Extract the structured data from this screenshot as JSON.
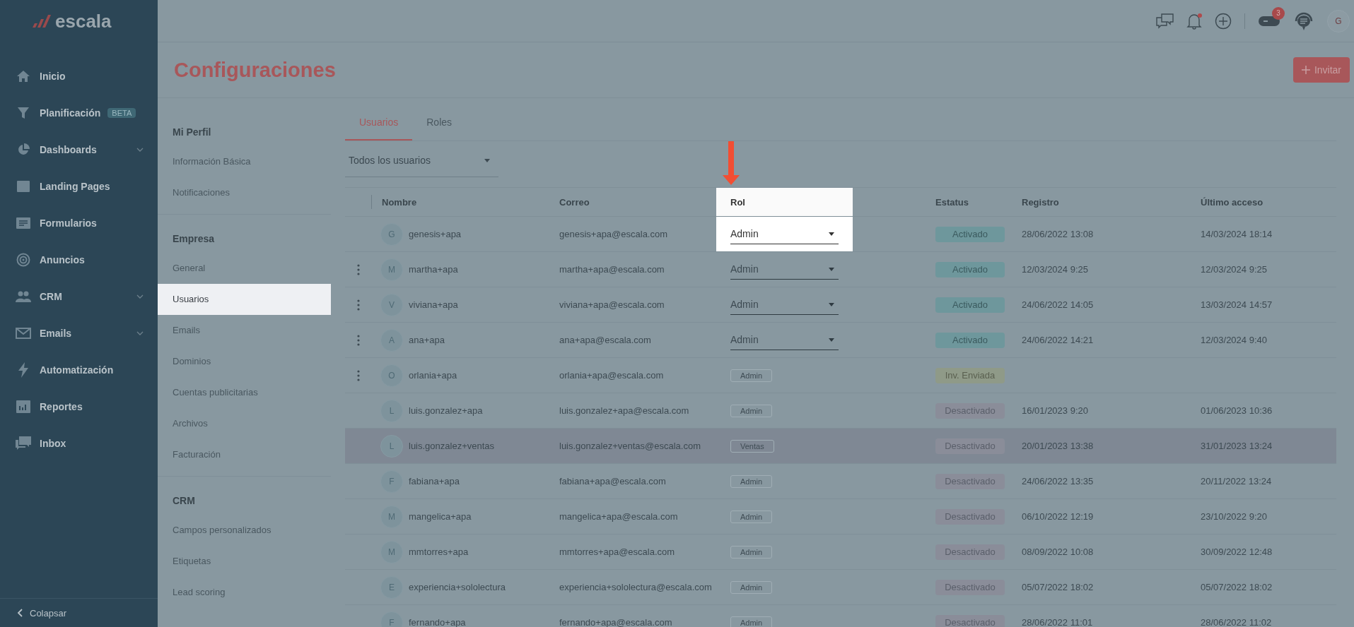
{
  "app": {
    "logo": "escala"
  },
  "sidebar": {
    "items": [
      {
        "kind": "home",
        "label": "Inicio",
        "expandable": false
      },
      {
        "kind": "filter",
        "label": "Planificación",
        "badge": "BETA",
        "expandable": false
      },
      {
        "kind": "pie",
        "label": "Dashboards",
        "expandable": true
      },
      {
        "kind": "page",
        "label": "Landing Pages",
        "expandable": false
      },
      {
        "kind": "form",
        "label": "Formularios",
        "expandable": false
      },
      {
        "kind": "target",
        "label": "Anuncios",
        "expandable": false
      },
      {
        "kind": "people",
        "label": "CRM",
        "expandable": true
      },
      {
        "kind": "mail",
        "label": "Emails",
        "expandable": true
      },
      {
        "kind": "bolt",
        "label": "Automatización",
        "expandable": false
      },
      {
        "kind": "chart",
        "label": "Reportes",
        "expandable": false
      },
      {
        "kind": "inbox",
        "label": "Inbox",
        "expandable": false
      }
    ],
    "collapse": "Colapsar"
  },
  "topbar": {
    "bell_unread": true,
    "games_badge": "3",
    "avatar": "G"
  },
  "page": {
    "title": "Configuraciones",
    "invite_button": "Invitar"
  },
  "settings_nav": [
    {
      "title": "Mi Perfil",
      "items": [
        {
          "label": "Información Básica",
          "selected": false
        },
        {
          "label": "Notificaciones",
          "selected": false
        }
      ]
    },
    {
      "title": "Empresa",
      "items": [
        {
          "label": "General",
          "selected": false
        },
        {
          "label": "Usuarios",
          "selected": true
        },
        {
          "label": "Emails",
          "selected": false
        },
        {
          "label": "Dominios",
          "selected": false
        },
        {
          "label": "Cuentas publicitarias",
          "selected": false
        },
        {
          "label": "Archivos",
          "selected": false
        },
        {
          "label": "Facturación",
          "selected": false
        }
      ]
    },
    {
      "title": "CRM",
      "items": [
        {
          "label": "Campos personalizados",
          "selected": false
        },
        {
          "label": "Etiquetas",
          "selected": false
        },
        {
          "label": "Lead scoring",
          "selected": false
        }
      ]
    }
  ],
  "tabs": [
    {
      "label": "Usuarios",
      "selected": true
    },
    {
      "label": "Roles",
      "selected": false
    }
  ],
  "filter": {
    "value": "Todos los usuarios"
  },
  "table": {
    "columns": [
      {
        "label": "Nombre",
        "spotlight": false
      },
      {
        "label": "Correo",
        "spotlight": false
      },
      {
        "label": "Rol",
        "spotlight": true
      },
      {
        "label": "Estatus",
        "spotlight": false
      },
      {
        "label": "Registro",
        "spotlight": false
      },
      {
        "label": "Último acceso",
        "spotlight": false
      }
    ],
    "rows": [
      {
        "initial": "G",
        "name": "genesis+apa",
        "email": "genesis+apa@escala.com",
        "role": {
          "label": "Admin",
          "kind": "select"
        },
        "status": {
          "label": "Activado",
          "kind": "active"
        },
        "registered": "28/06/2022 13:08",
        "last_access": "14/03/2024 18:14",
        "menu": false,
        "hovered": false,
        "spotlight": true
      },
      {
        "initial": "M",
        "name": "martha+apa",
        "email": "martha+apa@escala.com",
        "role": {
          "label": "Admin",
          "kind": "select"
        },
        "status": {
          "label": "Activado",
          "kind": "active"
        },
        "registered": "12/03/2024 9:25",
        "last_access": "12/03/2024 9:25",
        "menu": true,
        "hovered": false,
        "spotlight": false
      },
      {
        "initial": "V",
        "name": "viviana+apa",
        "email": "viviana+apa@escala.com",
        "role": {
          "label": "Admin",
          "kind": "select"
        },
        "status": {
          "label": "Activado",
          "kind": "active"
        },
        "registered": "24/06/2022 14:05",
        "last_access": "13/03/2024 14:57",
        "menu": true,
        "hovered": false,
        "spotlight": false
      },
      {
        "initial": "A",
        "name": "ana+apa",
        "email": "ana+apa@escala.com",
        "role": {
          "label": "Admin",
          "kind": "select"
        },
        "status": {
          "label": "Activado",
          "kind": "active"
        },
        "registered": "24/06/2022 14:21",
        "last_access": "12/03/2024 9:40",
        "menu": true,
        "hovered": false,
        "spotlight": false
      },
      {
        "initial": "O",
        "name": "orlania+apa",
        "email": "orlania+apa@escala.com",
        "role": {
          "label": "Admin",
          "kind": "tag"
        },
        "status": {
          "label": "Inv. Enviada",
          "kind": "invited"
        },
        "menu": true,
        "hovered": false,
        "spotlight": false
      },
      {
        "initial": "L",
        "name": "luis.gonzalez+apa",
        "email": "luis.gonzalez+apa@escala.com",
        "role": {
          "label": "Admin",
          "kind": "tag"
        },
        "status": {
          "label": "Desactivado",
          "kind": "inactive"
        },
        "registered": "16/01/2023 9:20",
        "last_access": "01/06/2023 10:36",
        "menu": false,
        "hovered": false,
        "spotlight": false
      },
      {
        "initial": "L",
        "name": "luis.gonzalez+ventas",
        "email": "luis.gonzalez+ventas@escala.com",
        "role": {
          "label": "Ventas",
          "kind": "tag"
        },
        "status": {
          "label": "Desactivado",
          "kind": "inactive"
        },
        "registered": "20/01/2023 13:38",
        "last_access": "31/01/2023 13:24",
        "menu": false,
        "hovered": true,
        "spotlight": false
      },
      {
        "initial": "F",
        "name": "fabiana+apa",
        "email": "fabiana+apa@escala.com",
        "role": {
          "label": "Admin",
          "kind": "tag"
        },
        "status": {
          "label": "Desactivado",
          "kind": "inactive"
        },
        "registered": "24/06/2022 13:35",
        "last_access": "20/11/2022 13:24",
        "menu": false,
        "hovered": false,
        "spotlight": false
      },
      {
        "initial": "M",
        "name": "mangelica+apa",
        "email": "mangelica+apa@escala.com",
        "role": {
          "label": "Admin",
          "kind": "tag"
        },
        "status": {
          "label": "Desactivado",
          "kind": "inactive"
        },
        "registered": "06/10/2022 12:19",
        "last_access": "23/10/2022 9:20",
        "menu": false,
        "hovered": false,
        "spotlight": false
      },
      {
        "initial": "M",
        "name": "mmtorres+apa",
        "email": "mmtorres+apa@escala.com",
        "role": {
          "label": "Admin",
          "kind": "tag"
        },
        "status": {
          "label": "Desactivado",
          "kind": "inactive"
        },
        "registered": "08/09/2022 10:08",
        "last_access": "30/09/2022 12:48",
        "menu": false,
        "hovered": false,
        "spotlight": false
      },
      {
        "initial": "E",
        "name": "experiencia+sololectura",
        "email": "experiencia+sololectura@escala.com",
        "role": {
          "label": "Admin",
          "kind": "tag"
        },
        "status": {
          "label": "Desactivado",
          "kind": "inactive"
        },
        "registered": "05/07/2022 18:02",
        "last_access": "05/07/2022 18:02",
        "menu": false,
        "hovered": false,
        "spotlight": false
      },
      {
        "initial": "F",
        "name": "fernando+apa",
        "email": "fernando+apa@escala.com",
        "role": {
          "label": "Admin",
          "kind": "tag"
        },
        "status": {
          "label": "Desactivado",
          "kind": "inactive"
        },
        "registered": "28/06/2022 11:01",
        "last_access": "28/06/2022 11:02",
        "menu": false,
        "hovered": false,
        "spotlight": false
      }
    ]
  }
}
